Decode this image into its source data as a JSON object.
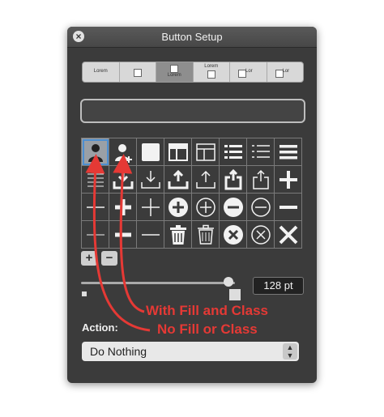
{
  "window": {
    "title": "Button Setup"
  },
  "segments": [
    {
      "label": "Lorem",
      "icon": "none"
    },
    {
      "label": "",
      "icon": "square"
    },
    {
      "label": "Lorem",
      "icon": "square",
      "selected": true
    },
    {
      "label": "Lorem",
      "icon": "square"
    },
    {
      "label": "Lor",
      "icon": "square"
    },
    {
      "label": "Lor",
      "icon": "square"
    }
  ],
  "icons": [
    "user-fill-icon",
    "user-add-icon",
    "square-fill-icon",
    "layout-header-icon",
    "layout-split-icon",
    "list-bullets-icon",
    "list-lines-icon",
    "menu-bars-icon",
    "lines-icon",
    "inbox-download-fill-icon",
    "download-icon",
    "upload-fill-icon",
    "upload-icon",
    "share-fill-icon",
    "share-icon",
    "plus-bold-icon",
    "minus-icon",
    "plus-fill-icon",
    "plus-thin-icon",
    "add-circle-fill-icon",
    "add-circle-icon",
    "remove-circle-fill-icon",
    "remove-circle-icon",
    "minus-bold-icon",
    "minus-thin-icon",
    "minus-fill-icon",
    "minus-light-icon",
    "trash-fill-icon",
    "trash-icon",
    "close-circle-fill-icon",
    "close-circle-icon",
    "close-icon"
  ],
  "size": {
    "value_text": "128 pt",
    "level": 0.96
  },
  "action": {
    "label": "Action:",
    "selected": "Do Nothing"
  },
  "annotations": {
    "with_fill": "With Fill and Class",
    "no_fill": "No Fill or Class"
  },
  "colors": {
    "annotation": "#e53935",
    "panel": "#3b3b3b",
    "selection": "#4d8fd1"
  }
}
